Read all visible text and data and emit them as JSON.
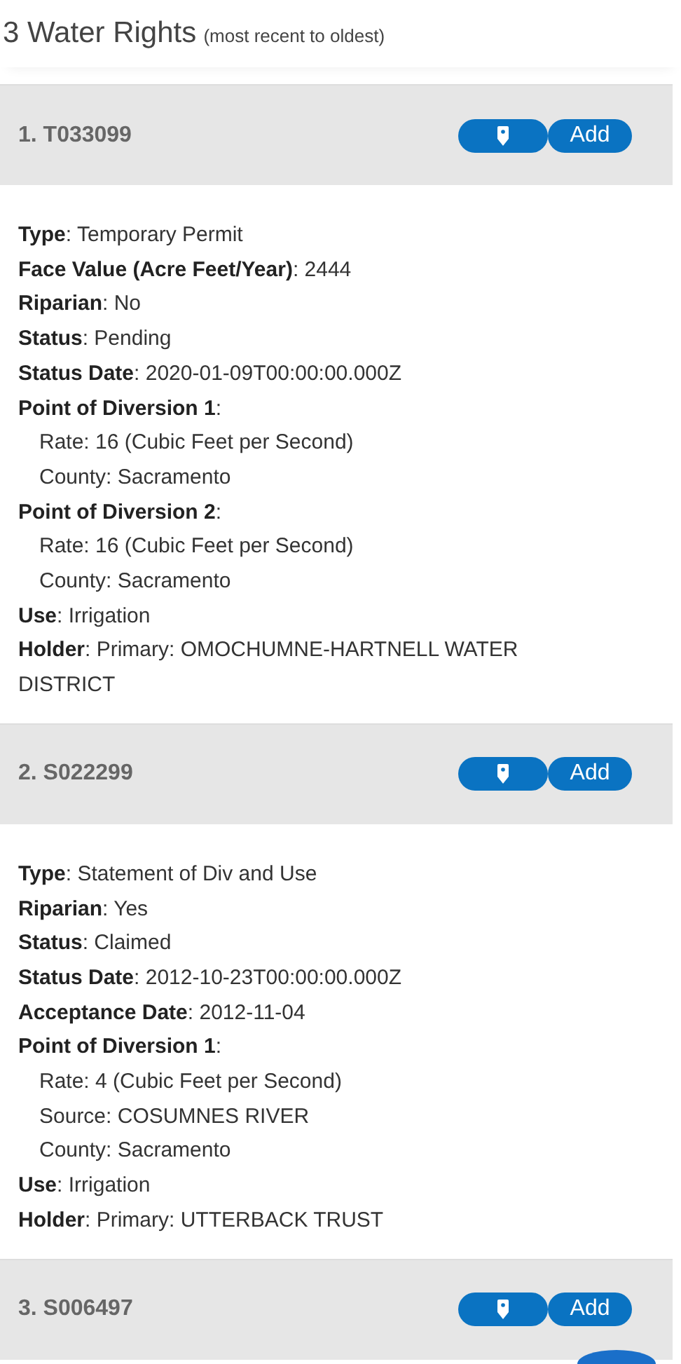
{
  "heading": {
    "title": "3 Water Rights",
    "subtitle": "(most recent to oldest)"
  },
  "records": [
    {
      "title": "1. T033099",
      "add_label": "Add",
      "fields": [
        {
          "text": "**Type**: Temporary Permit"
        },
        {
          "text": "**Face Value (Acre Feet/Year)**: 2444"
        },
        {
          "text": "**Riparian**: No"
        },
        {
          "text": "**Status**: Pending"
        },
        {
          "text": "**Status Date**: 2020-01-09T00:00:00.000Z"
        },
        {
          "text": "**Point of Diversion 1**:",
          "children": [
            "Rate: 16 (Cubic Feet per Second)",
            "County: Sacramento"
          ]
        },
        {
          "text": "**Point of Diversion 2**:",
          "children": [
            "Rate: 16 (Cubic Feet per Second)",
            "County: Sacramento"
          ]
        },
        {
          "text": "**Use**: Irrigation"
        },
        {
          "text": "**Holder**: Primary: OMOCHUMNE-HARTNELL WATER DISTRICT"
        }
      ]
    },
    {
      "title": "2. S022299",
      "add_label": "Add",
      "fields": [
        {
          "text": "**Type**: Statement of Div and Use"
        },
        {
          "text": "**Riparian**: Yes"
        },
        {
          "text": "**Status**: Claimed"
        },
        {
          "text": "**Status Date**: 2012-10-23T00:00:00.000Z"
        },
        {
          "text": "**Acceptance Date**: 2012-11-04"
        },
        {
          "text": "**Point of Diversion 1**:",
          "children": [
            "Rate: 4 (Cubic Feet per Second)",
            "Source: COSUMNES RIVER",
            "County: Sacramento"
          ]
        },
        {
          "text": "**Use**: Irrigation"
        },
        {
          "text": "**Holder**: Primary: UTTERBACK TRUST"
        }
      ]
    },
    {
      "title": "3. S006497",
      "add_label": "Add"
    }
  ]
}
